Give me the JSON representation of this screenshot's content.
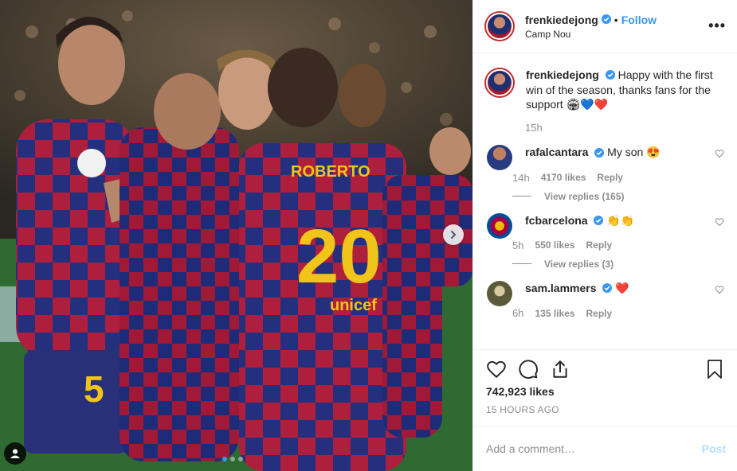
{
  "header": {
    "username": "frenkiedejong",
    "separator": "•",
    "follow_label": "Follow",
    "location": "Camp Nou",
    "more_label": "•••"
  },
  "caption": {
    "username": "frenkiedejong",
    "text": "Happy with the first win of the season, thanks fans for the support 🏟💙❤️",
    "time": "15h"
  },
  "comments": [
    {
      "username": "rafalcantara",
      "text": "My son 😍",
      "time": "14h",
      "likes": "4170 likes",
      "reply_label": "Reply",
      "view_replies": "View replies (165)",
      "verified": true
    },
    {
      "username": "fcbarcelona",
      "text": "👏👏",
      "time": "5h",
      "likes": "550 likes",
      "reply_label": "Reply",
      "view_replies": "View replies (3)",
      "verified": true
    },
    {
      "username": "sam.lammers",
      "text": "❤️",
      "time": "6h",
      "likes": "135 likes",
      "reply_label": "Reply",
      "view_replies": "",
      "verified": true
    }
  ],
  "actions": {
    "likes_count": "742,923 likes",
    "time_ago": "15 HOURS AGO"
  },
  "add_comment": {
    "placeholder": "Add a comment…",
    "post_label": "Post"
  },
  "media": {
    "jersey_number": "20",
    "jersey_name": "ROBERTO",
    "sponsor": "unicef",
    "carousel_dots": 3,
    "active_dot": 0
  },
  "colors": {
    "accent": "#3897f0",
    "post_disabled": "#b2dffc",
    "muted": "#8e8e8e",
    "text": "#262626",
    "heart_red": "#ed4956"
  }
}
